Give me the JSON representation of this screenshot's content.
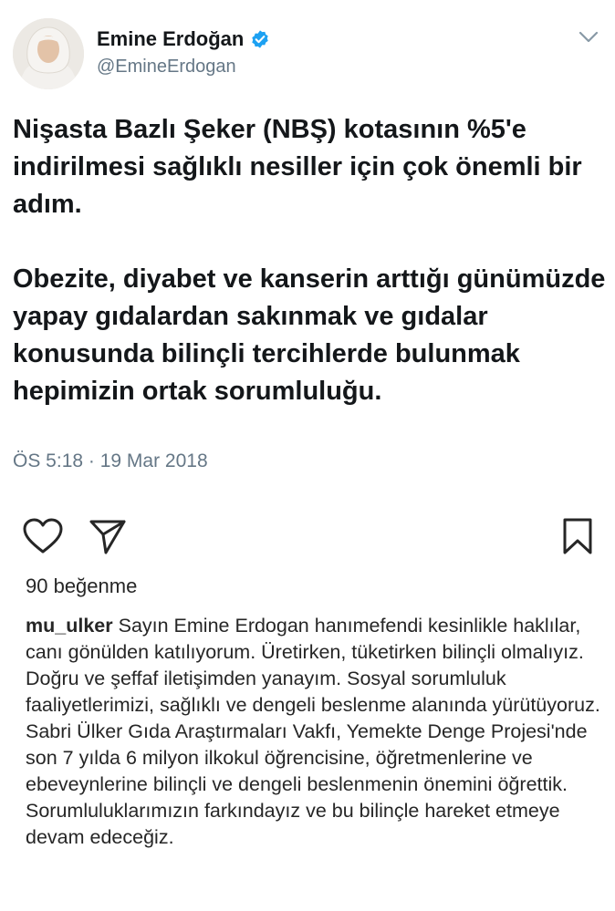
{
  "tweet": {
    "display_name": "Emine Erdoğan",
    "handle": "@EmineErdogan",
    "verified_icon": "verified-badge-icon",
    "menu_icon": "chevron-down-icon",
    "paragraph1": "Nişasta Bazlı Şeker (NBŞ) kotasının %5'e indirilmesi sağlıklı nesiller için çok önemli bir adım.",
    "paragraph2": "Obezite, diyabet ve kanserin arttığı günümüzde yapay gıdalardan sakınmak ve gıdalar konusunda bilinçli tercihlerde bulunmak hepimizin ortak sorumluluğu.",
    "timestamp": "ÖS 5:18 · 19 Mar 2018",
    "accent_color": "#1da1f2",
    "muted_color": "#657786"
  },
  "post": {
    "actions": [
      "heart-icon",
      "send-icon",
      "bookmark-icon"
    ],
    "likes": "90 beğenme",
    "comment_user": "mu_ulker",
    "comment_text": "Sayın Emine Erdogan hanımefendi kesinlikle haklılar, canı gönülden katılıyorum. Üretirken, tüketirken bilinçli olmalıyız. Doğru ve şeffaf iletişimden yanayım. Sosyal sorumluluk faaliyetlerimizi, sağlıklı ve dengeli beslenme alanında yürütüyoruz. Sabri Ülker Gıda Araştırmaları Vakfı, Yemekte Denge Projesi'nde son 7 yılda 6 milyon ilkokul öğrencisine, öğretmenlerine ve ebeveynlerine bilinçli ve dengeli beslenmenin önemini öğrettik. Sorumluluklarımızın farkındayız ve bu bilinçle hareket etmeye devam edeceğiz."
  }
}
